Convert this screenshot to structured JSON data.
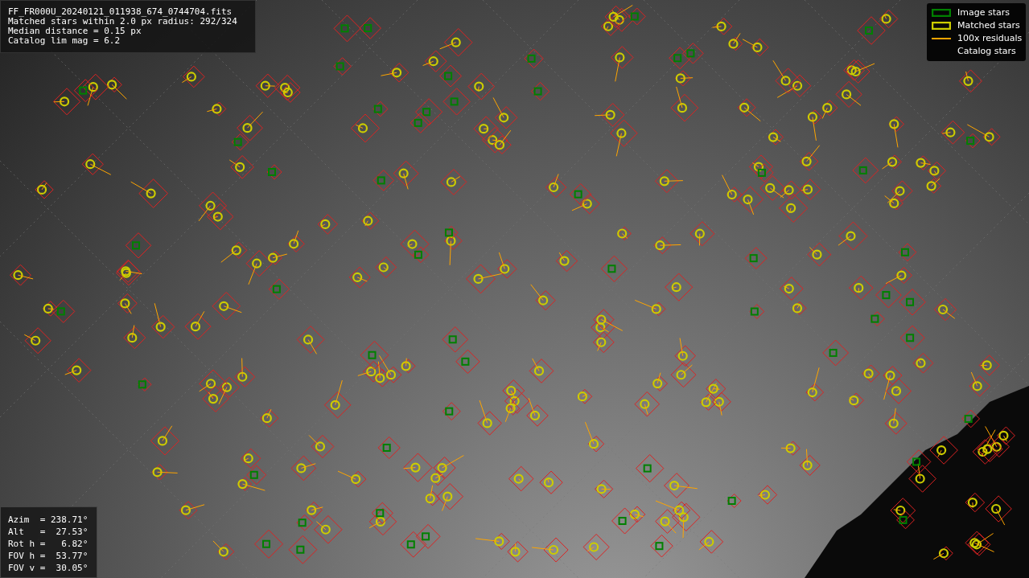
{
  "header": {
    "lines": [
      "FF_FR000U_20240121_011938_674_0744704.fits",
      "Matched stars within 2.0 px radius: 292/324",
      "Median distance = 0.15 px",
      "Catalog lim mag = 6.2"
    ]
  },
  "legend": {
    "items": [
      {
        "label": "Image stars",
        "kind": "box",
        "color": "#008000"
      },
      {
        "label": "Matched stars",
        "kind": "box",
        "color": "#cccc00"
      },
      {
        "label": "100x residuals",
        "kind": "line",
        "color": "#ffa500"
      },
      {
        "label": "Catalog stars",
        "kind": "blank"
      }
    ]
  },
  "pointing": {
    "lines": [
      "Azim  = 238.71°",
      "Alt   =  27.53°",
      "Rot h =   6.82°",
      "FOV h =  53.77°",
      "FOV v =  30.05°"
    ]
  }
}
